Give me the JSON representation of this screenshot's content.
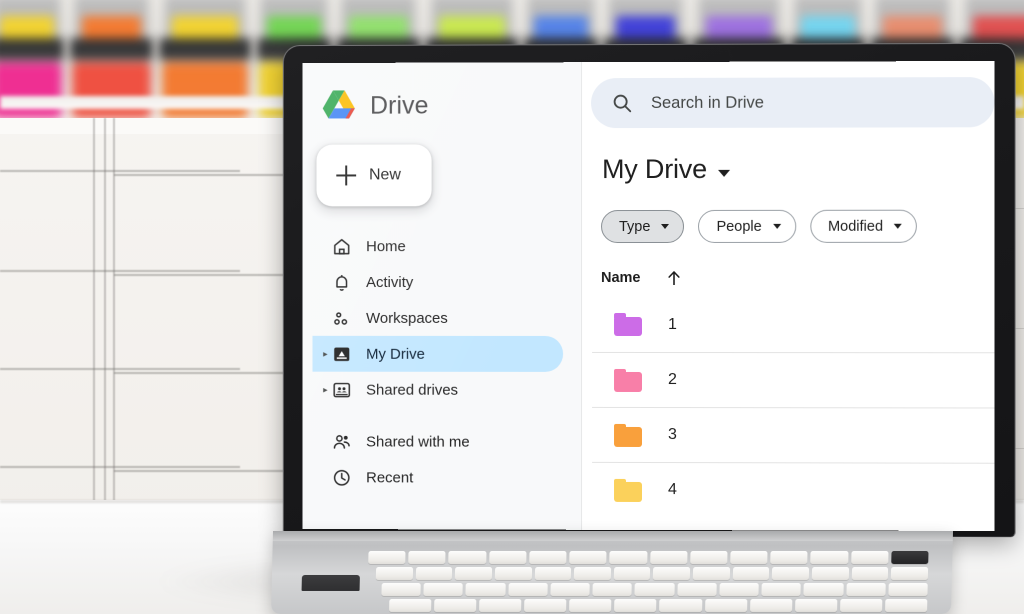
{
  "app": {
    "brand_name": "Drive",
    "logo_icon": "google-drive-logo"
  },
  "sidebar": {
    "new_button": {
      "label": "New",
      "icon": "plus-icon"
    },
    "items": [
      {
        "label": "Home",
        "icon": "home-icon",
        "active": false,
        "expandable": false
      },
      {
        "label": "Activity",
        "icon": "bell-icon",
        "active": false,
        "expandable": false
      },
      {
        "label": "Workspaces",
        "icon": "workspaces-icon",
        "active": false,
        "expandable": false
      },
      {
        "label": "My Drive",
        "icon": "my-drive-icon",
        "active": true,
        "expandable": true
      },
      {
        "label": "Shared drives",
        "icon": "shared-drives-icon",
        "active": false,
        "expandable": true
      },
      {
        "label": "Shared with me",
        "icon": "people-icon",
        "active": false,
        "expandable": false
      },
      {
        "label": "Recent",
        "icon": "clock-icon",
        "active": false,
        "expandable": false
      }
    ]
  },
  "search": {
    "placeholder": "Search in Drive",
    "icon": "search-icon"
  },
  "main": {
    "page_title": "My Drive",
    "title_caret_icon": "chevron-down-icon",
    "filters": [
      {
        "label": "Type",
        "selected": true
      },
      {
        "label": "People",
        "selected": false
      },
      {
        "label": "Modified",
        "selected": false
      }
    ],
    "columns": [
      {
        "label": "Name",
        "sort": "ascending",
        "sort_icon": "arrow-up-icon"
      }
    ],
    "files": [
      {
        "name": "1",
        "type": "folder",
        "color": "#cc6ce7"
      },
      {
        "name": "2",
        "type": "folder",
        "color": "#f87fa8"
      },
      {
        "name": "3",
        "type": "folder",
        "color": "#f9a03c"
      },
      {
        "name": "4",
        "type": "folder",
        "color": "#fbd15b"
      }
    ]
  },
  "theme": {
    "active_nav_bg": "#c2e7ff",
    "search_bg": "#e9eef6",
    "sidebar_bg": "#f8f9fa",
    "chip_selected_bg": "#dfe1e3",
    "text_primary": "#1f1f1f"
  },
  "photo": {
    "description": "blurred craft-room shelf with colorful supply jars above white drawer cabinets, laptop on white desk",
    "jar_colors": [
      "#f0268f",
      "#f04a3a",
      "#f4762a",
      "#f2d22a",
      "#4cc9a0",
      "#6fd44f",
      "#2fb84f",
      "#4f93e8"
    ],
    "cap_colors": [
      "#f2d22a",
      "#f4762a",
      "#f2d22a",
      "#6fd44f",
      "#8fe06a",
      "#c8e84a",
      "#4f7fe8",
      "#3a3ad8",
      "#9a6ce0",
      "#6fd4f0",
      "#e88a6a",
      "#e04a4a"
    ]
  }
}
